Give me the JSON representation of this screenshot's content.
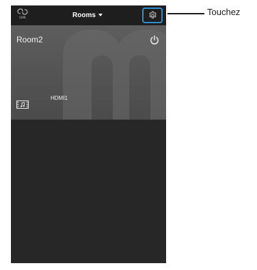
{
  "header": {
    "link_label": "Link",
    "rooms_label": "Rooms"
  },
  "room": {
    "name": "Room2",
    "input": "HDMI1"
  },
  "annotation": {
    "text": "Touchez"
  },
  "colors": {
    "settings_highlight": "#2e8fcf",
    "card_background": "#545454",
    "app_background": "#272727"
  },
  "icons": {
    "link": "link-icon",
    "settings": "gear-icon",
    "power": "power-icon",
    "input": "film-music-icon"
  }
}
